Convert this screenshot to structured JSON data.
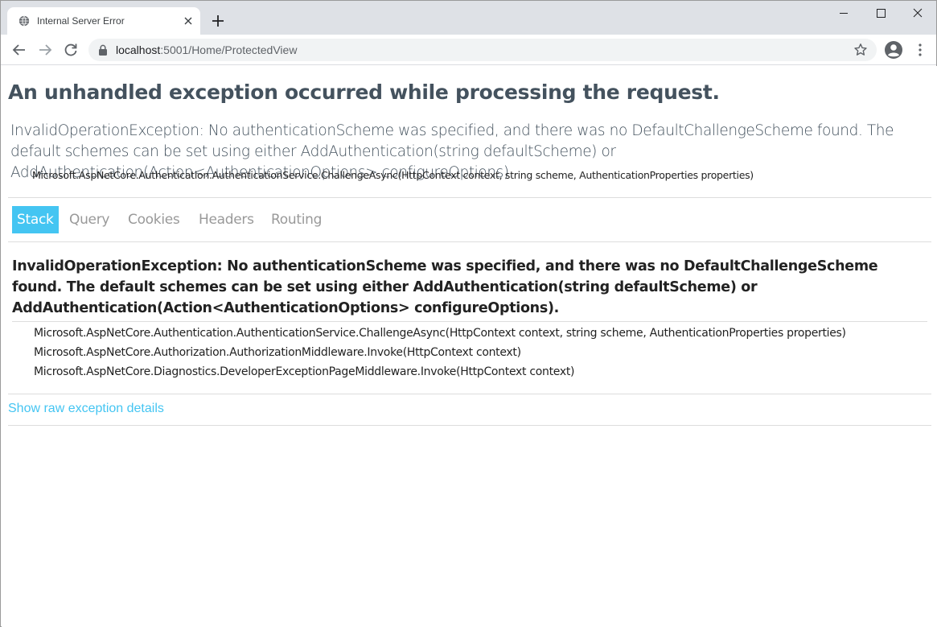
{
  "browser": {
    "tab": {
      "title": "Internal Server Error",
      "favicon": "globe-icon"
    },
    "address": {
      "host": "localhost",
      "path": ":5001/Home/ProtectedView"
    }
  },
  "page": {
    "title": "An unhandled exception occurred while processing the request.",
    "summary": "InvalidOperationException: No authenticationScheme was specified, and there was no DefaultChallengeScheme found. The default schemes can be set using either AddAuthentication(string defaultScheme) or AddAuthentication(Action<AuthenticationOptions> configureOptions).",
    "summary_frame": "Microsoft.AspNetCore.Authentication.AuthenticationService.ChallengeAsync(HttpContext context, string scheme, AuthenticationProperties properties)",
    "tabs": [
      "Stack",
      "Query",
      "Cookies",
      "Headers",
      "Routing"
    ],
    "active_tab": "Stack",
    "exception_title": "InvalidOperationException: No authenticationScheme was specified, and there was no DefaultChallengeScheme found. The default schemes can be set using either AddAuthentication(string defaultScheme) or AddAuthentication(Action<AuthenticationOptions> configureOptions).",
    "frames": [
      "Microsoft.AspNetCore.Authentication.AuthenticationService.ChallengeAsync(HttpContext context, string scheme, AuthenticationProperties properties)",
      "Microsoft.AspNetCore.Authorization.AuthorizationMiddleware.Invoke(HttpContext context)",
      "Microsoft.AspNetCore.Diagnostics.DeveloperExceptionPageMiddleware.Invoke(HttpContext context)"
    ],
    "raw_link": "Show raw exception details"
  },
  "colors": {
    "accent": "#44c5f2",
    "title": "#44525e",
    "muted": "#999999"
  }
}
